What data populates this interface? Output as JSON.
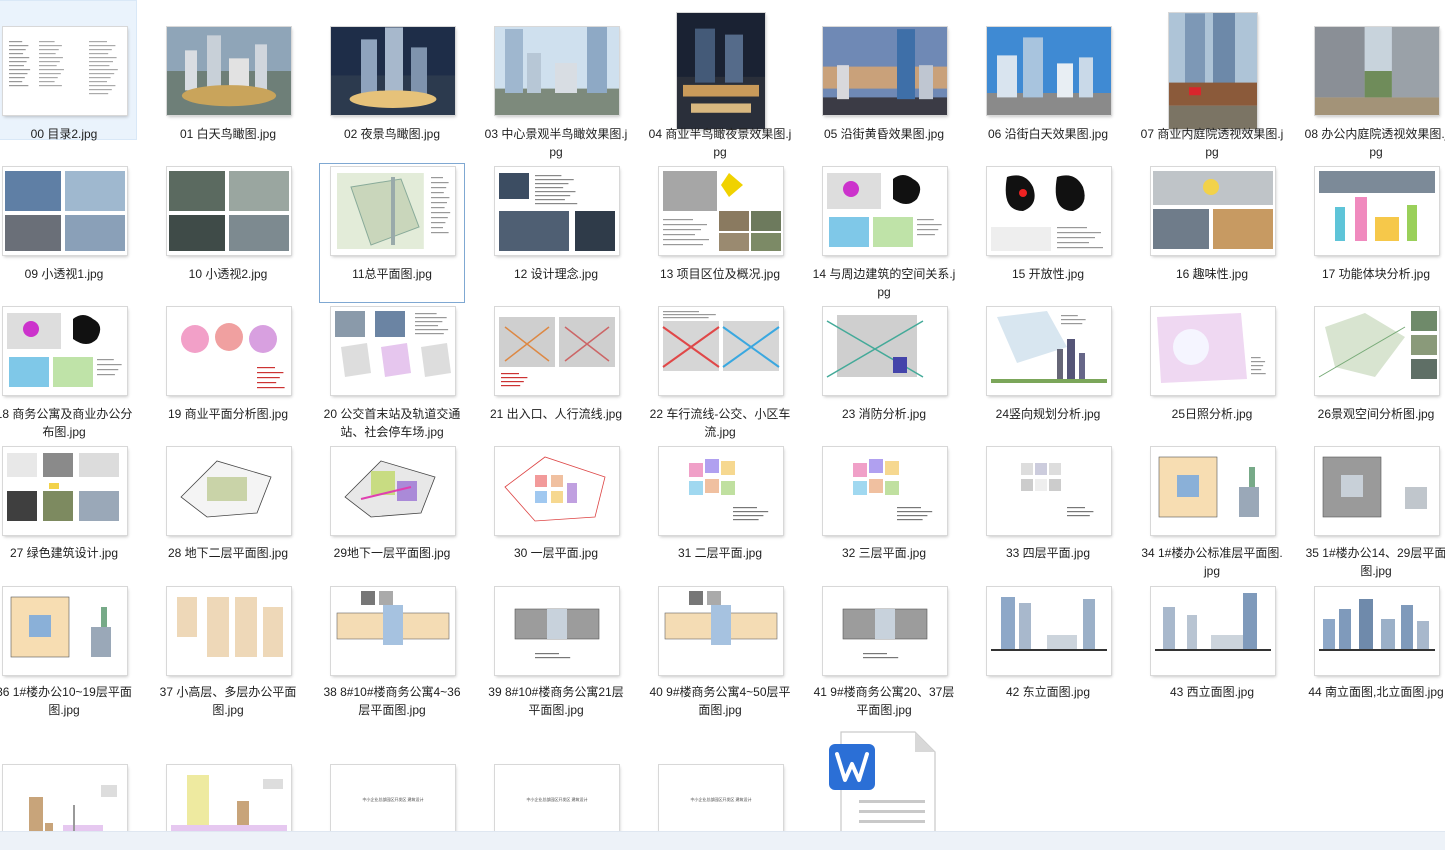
{
  "files": [
    {
      "name": "00 目录2.jpg",
      "type": "toc"
    },
    {
      "name": "01 白天鸟瞰图.jpg",
      "type": "photo-aerial-day"
    },
    {
      "name": "02 夜景鸟瞰图.jpg",
      "type": "photo-aerial-night"
    },
    {
      "name": "03 中心景观半鸟瞰效果图.jpg",
      "type": "photo-towers-day"
    },
    {
      "name": "04 商业半鸟瞰夜景效果图.jpg",
      "type": "photo-night-tall"
    },
    {
      "name": "05 沿街黄昏效果图.jpg",
      "type": "photo-dusk"
    },
    {
      "name": "06 沿街白天效果图.jpg",
      "type": "photo-street-day"
    },
    {
      "name": "07 商业内庭院透视效果图.jpg",
      "type": "photo-courtyard-tall"
    },
    {
      "name": "08 办公内庭院透视效果图.jpg",
      "type": "photo-office-court"
    },
    {
      "name": "09 小透视1.jpg",
      "type": "collage-blue"
    },
    {
      "name": "10 小透视2.jpg",
      "type": "collage-dark"
    },
    {
      "name": "11总平面图.jpg",
      "type": "siteplan"
    },
    {
      "name": "12 设计理念.jpg",
      "type": "concept"
    },
    {
      "name": "13 项目区位及概况.jpg",
      "type": "location"
    },
    {
      "name": "14 与周边建筑的空间关系.jpg",
      "type": "diagram-color"
    },
    {
      "name": "15 开放性.jpg",
      "type": "diagram-bw"
    },
    {
      "name": "16 趣味性.jpg",
      "type": "collage-light"
    },
    {
      "name": "17 功能体块分析.jpg",
      "type": "massing"
    },
    {
      "name": "18 商务公寓及商业办公分布图.jpg",
      "type": "diagram-color"
    },
    {
      "name": "19 商业平面分析图.jpg",
      "type": "plan-pink"
    },
    {
      "name": "20 公交首末站及轨道交通站、社会停车场.jpg",
      "type": "plan-photos"
    },
    {
      "name": "21 出入口、人行流线.jpg",
      "type": "plan-gray"
    },
    {
      "name": "22 车行流线-公交、小区车流.jpg",
      "type": "plan-gray-blue"
    },
    {
      "name": "23 消防分析.jpg",
      "type": "plan-green"
    },
    {
      "name": "24竖向规划分析.jpg",
      "type": "plan-section"
    },
    {
      "name": "25日照分析.jpg",
      "type": "plan-sun"
    },
    {
      "name": "26景观空间分析图.jpg",
      "type": "plan-landscape"
    },
    {
      "name": "27 绿色建筑设计.jpg",
      "type": "green-arch"
    },
    {
      "name": "28 地下二层平面图.jpg",
      "type": "floor-b2"
    },
    {
      "name": "29地下一层平面图.jpg",
      "type": "floor-b1"
    },
    {
      "name": "30 一层平面.jpg",
      "type": "floor-1"
    },
    {
      "name": "31 二层平面.jpg",
      "type": "floor-2"
    },
    {
      "name": "32 三层平面.jpg",
      "type": "floor-3"
    },
    {
      "name": "33 四层平面.jpg",
      "type": "floor-4"
    },
    {
      "name": "34 1#楼办公标准层平面图.jpg",
      "type": "tower-plan"
    },
    {
      "name": "35 1#楼办公14、29层平面图.jpg",
      "type": "tower-plan-gray"
    },
    {
      "name": "36 1#楼办公10~19层平面图.jpg",
      "type": "tower-plan"
    },
    {
      "name": "37 小高层、多层办公平面图.jpg",
      "type": "slab-plans"
    },
    {
      "name": "38 8#10#楼商务公寓4~36层平面图.jpg",
      "type": "apt-plan"
    },
    {
      "name": "39 8#10#楼商务公寓21层平面图.jpg",
      "type": "apt-plan-gray"
    },
    {
      "name": "40 9#楼商务公寓4~50层平面图.jpg",
      "type": "apt-plan-tall"
    },
    {
      "name": "41 9#楼商务公寓20、37层平面图.jpg",
      "type": "apt-plan-gray-tall"
    },
    {
      "name": "42 东立面图.jpg",
      "type": "elev-east"
    },
    {
      "name": "43 西立面图.jpg",
      "type": "elev-west"
    },
    {
      "name": "44 南立面图,北立面图.jpg",
      "type": "elev-south"
    },
    {
      "name": "",
      "type": "bars1"
    },
    {
      "name": "",
      "type": "bars2"
    },
    {
      "name": "",
      "type": "text-page"
    },
    {
      "name": "",
      "type": "text-page"
    },
    {
      "name": "",
      "type": "text-page"
    },
    {
      "name": "",
      "type": "word-doc"
    }
  ],
  "pages": {
    "title_page_text": "中小企业总部园区开发区 建筑设计"
  },
  "colors": {
    "selection": "#eaf3fc",
    "focus_border": "#7fa8d2",
    "word_blue": "#2b6fd6"
  },
  "state": {
    "selected_index": 0,
    "focused_index": 11
  },
  "icons": {
    "document": "word-document-icon"
  }
}
